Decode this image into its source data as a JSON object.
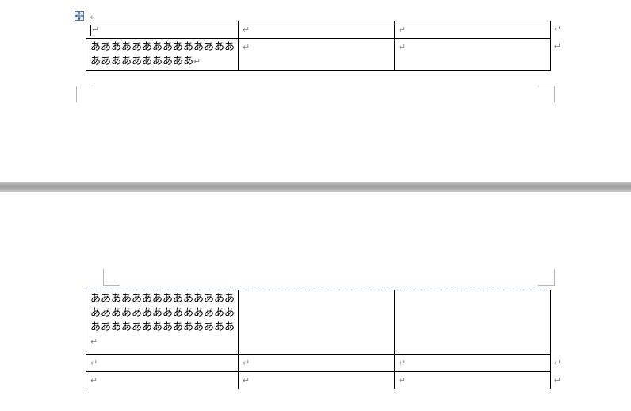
{
  "marks": {
    "paragraph": "↲",
    "cell": "↵"
  },
  "page1": {
    "table": {
      "rows": [
        {
          "cells": [
            "",
            "",
            ""
          ],
          "has_cursor": true
        },
        {
          "cells": [
            "ああああああああああああああああああああああああ",
            "",
            ""
          ]
        }
      ]
    }
  },
  "page2": {
    "table": {
      "rows": [
        {
          "cells": [
            "ああああああああああああああああああああああああああああああああああああああああああ",
            "",
            ""
          ]
        },
        {
          "cells": [
            "",
            "",
            ""
          ]
        },
        {
          "cells": [
            "",
            "",
            ""
          ]
        }
      ]
    }
  }
}
